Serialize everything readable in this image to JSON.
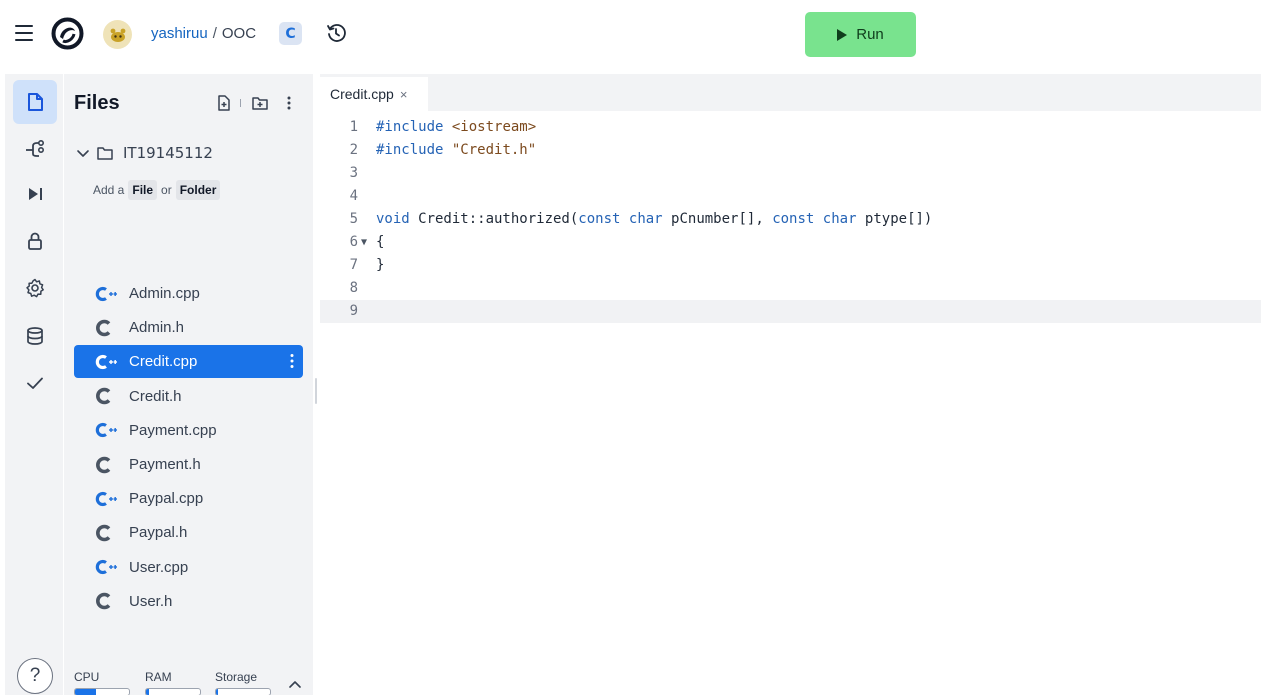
{
  "header": {
    "breadcrumb_user": "yashiruu",
    "breadcrumb_separator": "/",
    "repl_name": "OOC",
    "language_badge": "C",
    "run_label": "Run",
    "run_color": "#79e38e"
  },
  "rail": {
    "items": [
      {
        "icon": "file-icon",
        "active": true
      },
      {
        "icon": "version-control-icon",
        "active": false
      },
      {
        "icon": "run-debug-icon",
        "active": false
      },
      {
        "icon": "lock-icon",
        "active": false
      },
      {
        "icon": "gear-icon",
        "active": false
      },
      {
        "icon": "database-icon",
        "active": false
      },
      {
        "icon": "checkmark-icon",
        "active": false
      }
    ],
    "help_label": "?"
  },
  "files": {
    "title": "Files",
    "folder_name": "IT19145112",
    "add_hint": {
      "prefix": "Add a",
      "file_label": "File",
      "or_label": "or",
      "folder_label": "Folder"
    },
    "items": [
      {
        "name": "Admin.cpp",
        "type": "cpp"
      },
      {
        "name": "Admin.h",
        "type": "h"
      },
      {
        "name": "Credit.cpp",
        "type": "cpp",
        "selected": true
      },
      {
        "name": "Credit.h",
        "type": "h"
      },
      {
        "name": "Payment.cpp",
        "type": "cpp"
      },
      {
        "name": "Payment.h",
        "type": "h"
      },
      {
        "name": "Paypal.cpp",
        "type": "cpp"
      },
      {
        "name": "Paypal.h",
        "type": "h"
      },
      {
        "name": "User.cpp",
        "type": "cpp"
      },
      {
        "name": "User.h",
        "type": "h"
      }
    ],
    "resources": {
      "cpu_label": "CPU",
      "ram_label": "RAM",
      "storage_label": "Storage",
      "cpu_usage": 0.38,
      "ram_usage": 0.05,
      "storage_usage": 0.03
    }
  },
  "editor": {
    "tab_label": "Credit.cpp",
    "tab_close": "×",
    "current_line": 9,
    "lines": [
      {
        "num": "1",
        "text": "#include <iostream>"
      },
      {
        "num": "2",
        "text": "#include \"Credit.h\""
      },
      {
        "num": "3",
        "text": ""
      },
      {
        "num": "4",
        "text": ""
      },
      {
        "num": "5",
        "text": "void Credit::authorized(const char pCnumber[], const char ptype[])"
      },
      {
        "num": "6",
        "text": "{"
      },
      {
        "num": "7",
        "text": "}"
      },
      {
        "num": "8",
        "text": ""
      },
      {
        "num": "9",
        "text": ""
      }
    ]
  }
}
